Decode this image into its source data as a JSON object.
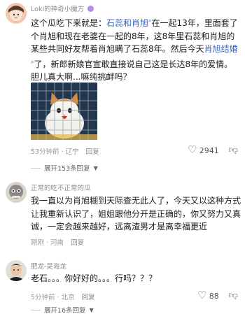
{
  "comments": [
    {
      "username": "Loki的神奇小魔方",
      "text_parts": [
        {
          "t": "这个瓜吃下来就是：",
          "hl": false
        },
        {
          "t": "石蕊和肖旭",
          "hl": true
        },
        {
          "t": "在一起13年，里面套了个肖旭和现在老婆在一起的8年，这8年里石蕊和肖旭的某些共同好友帮着肖旭瞒了石蕊8年。然后今天",
          "hl": false
        },
        {
          "t": "肖旭结婚",
          "hl": true
        },
        {
          "t": "了，新郎新娘官宣敢直接说自己这是长达8年的爱情。胆儿真大啊...嘛纯挑衅吗？",
          "hl": false
        }
      ],
      "time": "53分钟前 · 辽宁",
      "reply_label": "回复",
      "likes": "2941",
      "expand_label": "展开153条回复"
    },
    {
      "username": "正常的吃不正常的瓜",
      "text": "我一直以为肖旭糊到天际查无此人了，今天又以这种方式让我重新认识了，姐姐跟他分开是正确的，你又努力又真诚，一定会越来越好，远离渣男才是离幸福更近",
      "time": "刚刚 · 河南",
      "reply_label": "回复"
    },
    {
      "username": "肥龙-吴海龙",
      "text": "老石。。。你好好的。。。行吗？？？",
      "time": "5分钟前 · 北京",
      "reply_label": "回复",
      "likes": "88",
      "expand_label": "展开16条回复"
    }
  ],
  "icons": {
    "heart": "heart-icon",
    "dislike": "thumbs-down-icon",
    "search": "search-icon",
    "chevron": "chevron-down-icon"
  },
  "colors": {
    "highlight": "#3a62b8",
    "meta": "#9a9a9a"
  }
}
